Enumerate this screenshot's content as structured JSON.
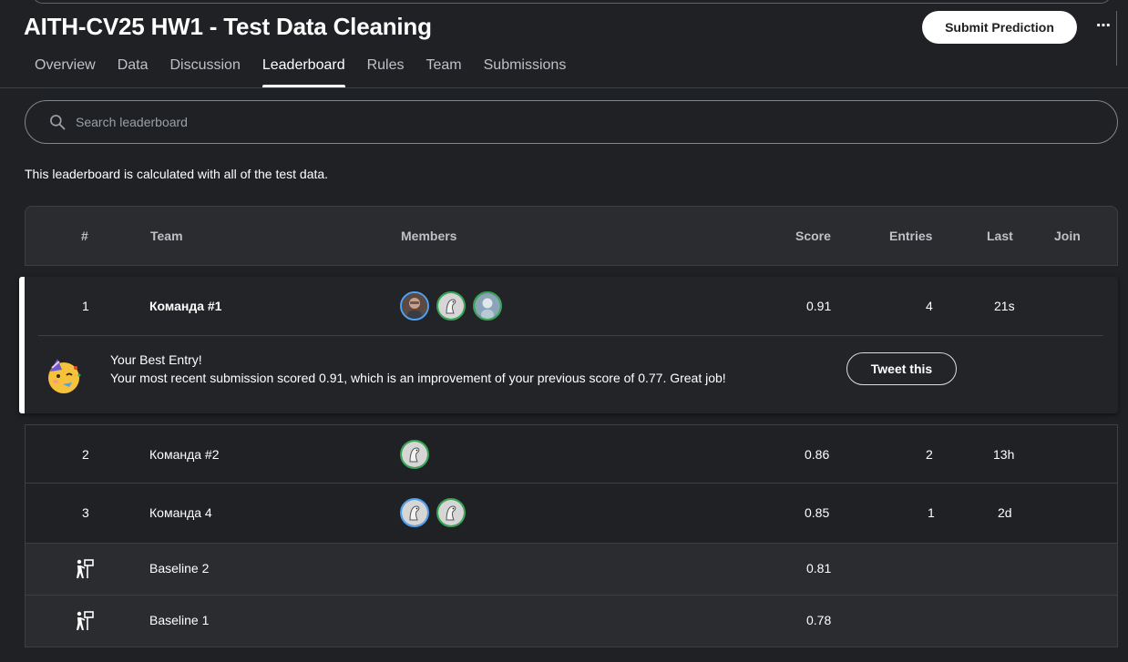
{
  "header": {
    "title": "AITH-CV25 HW1 - Test Data Cleaning",
    "submit_label": "Submit Prediction",
    "more_label": "⋯"
  },
  "tabs": [
    {
      "label": "Overview"
    },
    {
      "label": "Data"
    },
    {
      "label": "Discussion"
    },
    {
      "label": "Leaderboard"
    },
    {
      "label": "Rules"
    },
    {
      "label": "Team"
    },
    {
      "label": "Submissions"
    }
  ],
  "active_tab": "Leaderboard",
  "search": {
    "placeholder": "Search leaderboard"
  },
  "note": "This leaderboard is calculated with all of the test data.",
  "table": {
    "headers": {
      "rank": "#",
      "team": "Team",
      "members": "Members",
      "score": "Score",
      "entries": "Entries",
      "last": "Last",
      "join": "Join"
    },
    "rows": [
      {
        "rank": "1",
        "team": "Команда #1",
        "members": 3,
        "score": "0.91",
        "entries": "4",
        "last": "21s"
      },
      {
        "rank": "2",
        "team": "Команда #2",
        "members": 1,
        "score": "0.86",
        "entries": "2",
        "last": "13h"
      },
      {
        "rank": "3",
        "team": "Команда 4",
        "members": 2,
        "score": "0.85",
        "entries": "1",
        "last": "2d"
      }
    ],
    "baselines": [
      {
        "icon": "baseline-icon",
        "team": "Baseline 2",
        "score": "0.81"
      },
      {
        "icon": "baseline-icon",
        "team": "Baseline 1",
        "score": "0.78"
      }
    ]
  },
  "best_entry": {
    "title": "Your Best Entry!",
    "text": "Your most recent submission scored 0.91, which is an improvement of your previous score of 0.77. Great job!",
    "tweet_label": "Tweet this",
    "icon": "party-face-icon"
  },
  "colors": {
    "background": "#202124",
    "highlight": "#ffffff",
    "ring_blue": "#4ea1f3",
    "ring_green": "#34a853"
  }
}
